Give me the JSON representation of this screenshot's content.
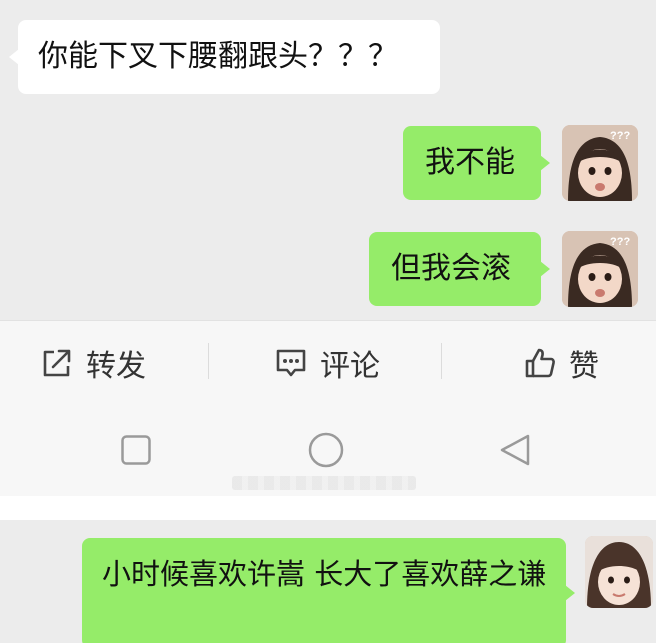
{
  "chat_top": {
    "incoming_message": "你能下叉下腰翻跟头？？？",
    "outgoing_messages": [
      {
        "text": "我不能"
      },
      {
        "text": "但我会滚"
      }
    ]
  },
  "action_bar": {
    "forward_label": "转发",
    "comment_label": "评论",
    "like_label": "赞"
  },
  "nav_bar": {
    "buttons": [
      "recent-apps",
      "home",
      "back"
    ]
  },
  "chat_bottom": {
    "outgoing_message": "小时候喜欢许嵩 长大了喜欢薛之谦"
  },
  "colors": {
    "outgoing_bubble": "#95ec69",
    "incoming_bubble": "#ffffff",
    "chat_background": "#ececec",
    "bar_background": "#f7f7f7"
  }
}
